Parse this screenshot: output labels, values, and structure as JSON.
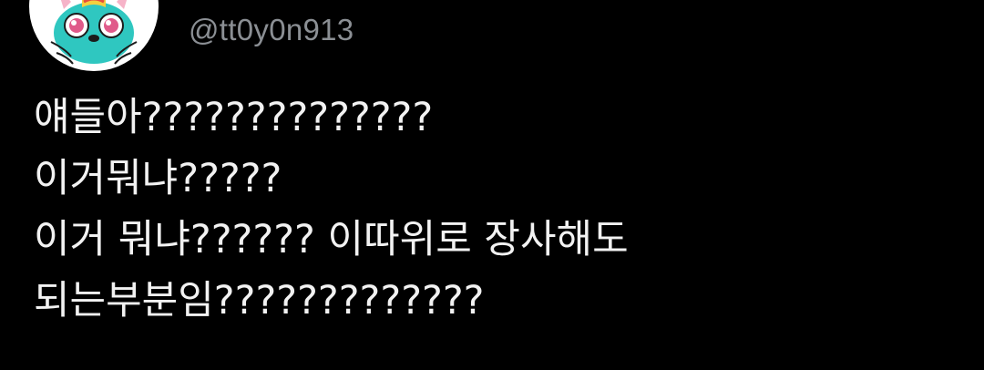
{
  "user": {
    "handle": "@tt0y0n913"
  },
  "tweet": {
    "lines": [
      "얘들아??????????????",
      "이거뭐냐?????",
      "이거 뭐냐?????? 이따위로 장사해도",
      "되는부분임?????????????"
    ]
  },
  "colors": {
    "background": "#000000",
    "text": "#f2f2f2",
    "handle": "#8b8f94",
    "avatar_accent": "#2fc7c0"
  },
  "icons": {
    "avatar": "cartoon-cat-avatar-icon"
  }
}
